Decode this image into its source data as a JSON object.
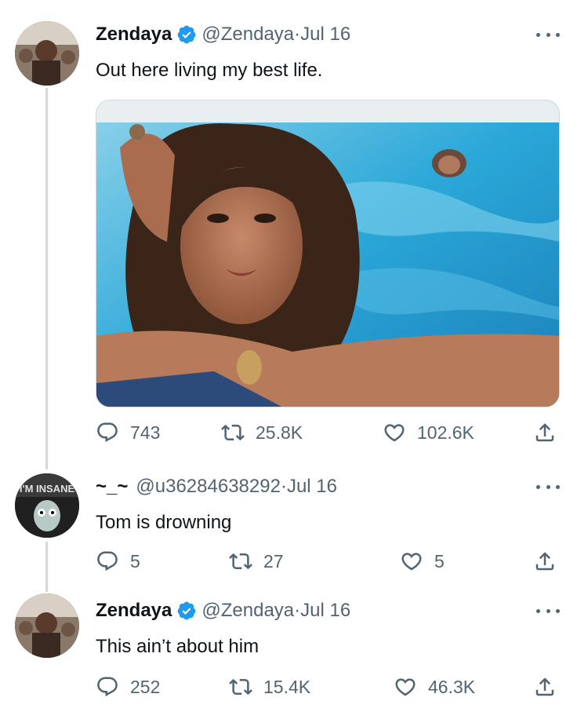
{
  "tweets": [
    {
      "name": "Zendaya",
      "handle": "@Zendaya",
      "date": "Jul 16",
      "text": "Out here living my best life.",
      "replies": "743",
      "retweets": "25.8K",
      "likes": "102.6K",
      "verified": true
    },
    {
      "name": "~_~",
      "handle": "@u36284638292",
      "date": "Jul 16",
      "text": "Tom is drowning",
      "replies": "5",
      "retweets": "27",
      "likes": "5",
      "verified": false
    },
    {
      "name": "Zendaya",
      "handle": "@Zendaya",
      "date": "Jul 16",
      "text": "This ain’t about him",
      "replies": "252",
      "retweets": "15.4K",
      "likes": "46.3K",
      "verified": true
    }
  ],
  "separator": " · ",
  "avatar_text": "I'M INSANE",
  "colors": {
    "verified_blue": "#1d9bf0",
    "secondary_text": "#536471",
    "thread_line": "#cfd9de",
    "pool_blue": "#2aa7d8"
  },
  "icons": [
    "reply-icon",
    "retweet-icon",
    "like-icon",
    "share-icon",
    "more-icon",
    "verified-badge-icon"
  ]
}
